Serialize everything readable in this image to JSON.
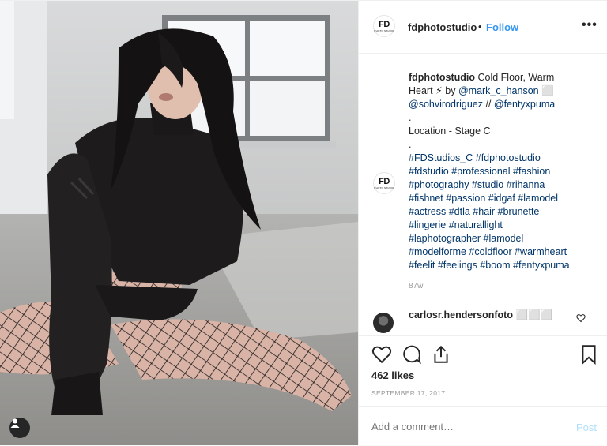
{
  "account": {
    "username": "fdphotostudio",
    "separator": "•",
    "follow_label": "Follow",
    "logo_main": "FD",
    "logo_sub": "PHOTO STUDIO",
    "more_label": "•••"
  },
  "caption": {
    "username": "fdphotostudio",
    "line1": "Cold Floor, Warm",
    "line2_prefix": "Heart ⚡ by ",
    "mention1": "@mark_c_hanson",
    "mention1_suffix": " ⬜",
    "mention2": "@sohvirodriguez",
    "separator": " // ",
    "mention3": "@fentyxpuma",
    "dot1": ".",
    "location": "Location - Stage C",
    "dot2": ".",
    "hashtags": [
      "#FDStudios_C #fdphotostudio",
      "#fdstudio #professional #fashion",
      "#photography #studio #rihanna",
      "#fishnet #passion #idgaf #lamodel",
      "#actress #dtla #hair #brunette",
      "#lingerie #naturallight",
      "#laphotographer #lamodel",
      "#modelforme #coldfloor #warmheart",
      "#feelit #feelings #boom #fentyxpuma"
    ],
    "age": "87w"
  },
  "comment": {
    "username": "carlosr.hendersonfoto",
    "text": "⬜⬜⬜"
  },
  "likes": "462 likes",
  "date": "SEPTEMBER 17, 2017",
  "add_comment": {
    "placeholder": "Add a comment…",
    "post_label": "Post"
  },
  "colors": {
    "link_blue": "#3897f0",
    "hashtag_blue": "#003569",
    "post_disabled": "#b2dffc",
    "muted": "#999999"
  }
}
